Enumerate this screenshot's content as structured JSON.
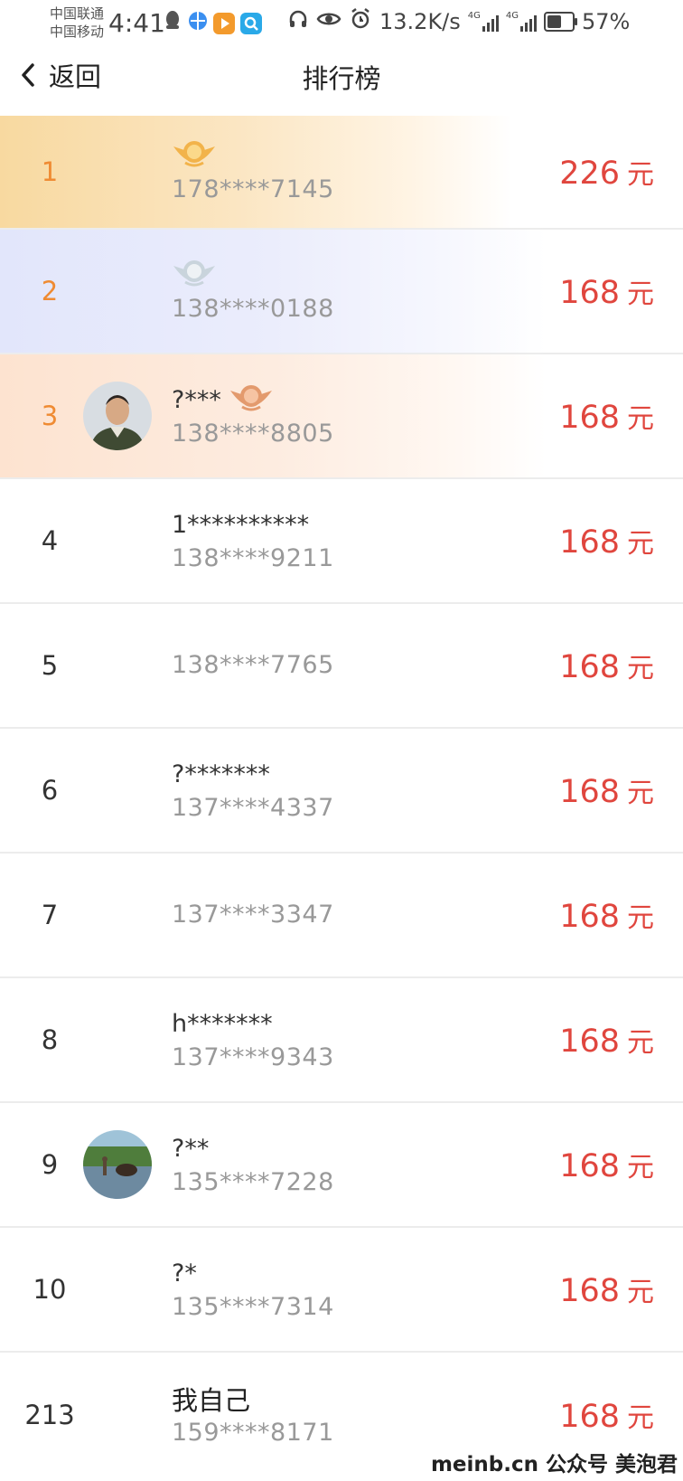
{
  "status_bar": {
    "carrier_1": "中国联通",
    "carrier_2": "中国移动",
    "time": "4:41",
    "net_speed": "13.2K/s",
    "net_type_1": "4G",
    "net_type_2": "4G",
    "battery": "57%",
    "battery_level": 0.57,
    "icons": [
      "qq-icon",
      "browser-icon",
      "video-app-icon",
      "search-app-icon",
      "headphones-icon",
      "eye-icon",
      "alarm-icon"
    ]
  },
  "nav": {
    "back_label": "返回",
    "title": "排行榜"
  },
  "rows": [
    {
      "rank": "1",
      "name": "",
      "badge": "gold",
      "phone": "178****7145",
      "amount": "226",
      "unit": "元"
    },
    {
      "rank": "2",
      "name": "",
      "badge": "silver",
      "phone": "138****0188",
      "amount": "168",
      "unit": "元"
    },
    {
      "rank": "3",
      "name": "?***",
      "badge": "bronze",
      "avatar": "man-portrait",
      "phone": "138****8805",
      "amount": "168",
      "unit": "元"
    },
    {
      "rank": "4",
      "name": "1**********",
      "phone": "138****9211",
      "amount": "168",
      "unit": "元"
    },
    {
      "rank": "5",
      "name": "",
      "phone": "138****7765",
      "amount": "168",
      "unit": "元"
    },
    {
      "rank": "6",
      "name": "?*******",
      "phone": "137****4337",
      "amount": "168",
      "unit": "元"
    },
    {
      "rank": "7",
      "name": "",
      "phone": "137****3347",
      "amount": "168",
      "unit": "元"
    },
    {
      "rank": "8",
      "name": "h*******",
      "phone": "137****9343",
      "amount": "168",
      "unit": "元"
    },
    {
      "rank": "9",
      "name": "?**",
      "avatar": "landscape-photo",
      "phone": "135****7228",
      "amount": "168",
      "unit": "元"
    },
    {
      "rank": "10",
      "name": "?*",
      "phone": "135****7314",
      "amount": "168",
      "unit": "元"
    }
  ],
  "my_row": {
    "rank": "213",
    "name": "我自己",
    "phone": "159****8171",
    "amount": "168",
    "unit": "元"
  },
  "watermark": "meinb.cn  公众号 美泡君",
  "colors": {
    "amount": "#e0463e",
    "top_rank": "#ef8b33",
    "gold": "#f2b34a",
    "silver": "#c9d4dc",
    "bronze": "#e39a6d"
  }
}
